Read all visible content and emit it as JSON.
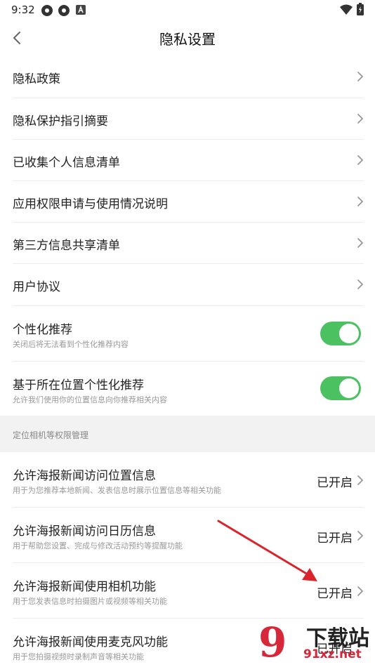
{
  "status_bar": {
    "time": "9:32"
  },
  "header": {
    "title": "隐私设置"
  },
  "rows": [
    {
      "label": "隐私政策"
    },
    {
      "label": "隐私保护指引摘要"
    },
    {
      "label": "已收集个人信息清单"
    },
    {
      "label": "应用权限申请与使用情况说明"
    },
    {
      "label": "第三方信息共享清单"
    },
    {
      "label": "用户协议"
    }
  ],
  "toggles": [
    {
      "label": "个性化推荐",
      "sub": "关闭后将无法看到个性化推荐内容",
      "on": true
    },
    {
      "label": "基于所在位置个性化推荐",
      "sub": "允许我们使用你的位置信息向你推荐相关内容",
      "on": true
    }
  ],
  "section": {
    "title": "定位相机等权限管理"
  },
  "permissions": [
    {
      "label": "允许海报新闻访问位置信息",
      "sub": "用于为您推荐本地新闻、发表信息时展示位置信息等相关功能",
      "status": "已开启"
    },
    {
      "label": "允许海报新闻访问日历信息",
      "sub": "用于帮助您设置、完成与修改活动预约等提醒功能",
      "status": "已开启"
    },
    {
      "label": "允许海报新闻使用相机功能",
      "sub": "用于您发表信息时拍摄图片或视频等相关功能",
      "status": "已开启"
    },
    {
      "label": "允许海报新闻使用麦克风功能",
      "sub": "用于您拍摄视频时录制声音等相关功能",
      "status": "已开启"
    }
  ],
  "watermark": {
    "logo": "9",
    "title": "下载站",
    "url": "91xz.net"
  },
  "colors": {
    "toggle_on": "#4cc161",
    "annotation_arrow": "#d9242c",
    "section_bg": "#f2f2f2"
  }
}
